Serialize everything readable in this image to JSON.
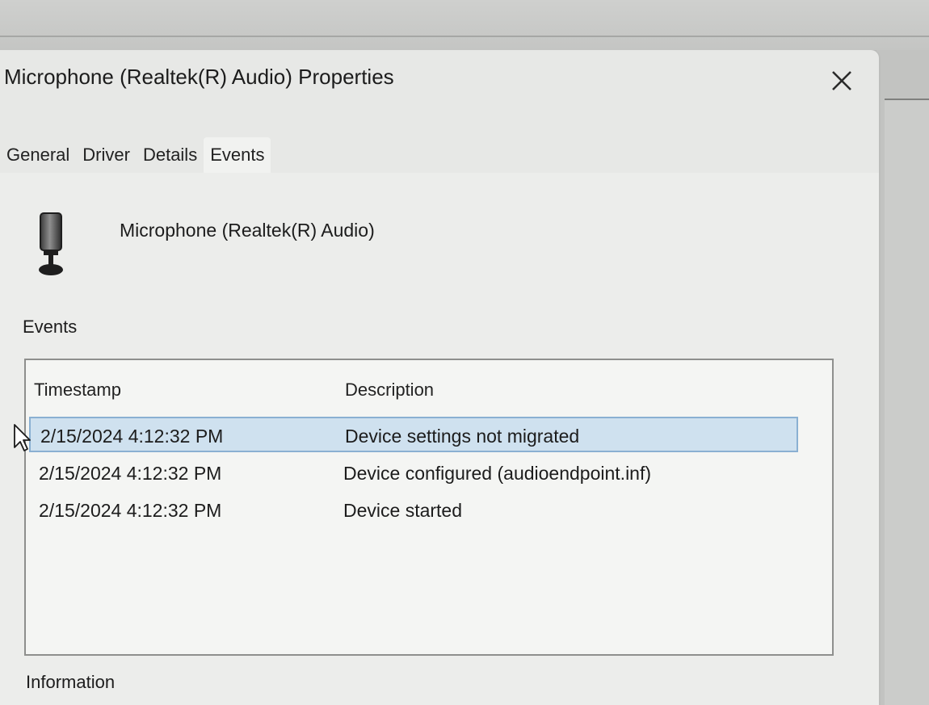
{
  "window": {
    "title": "Microphone (Realtek(R) Audio) Properties",
    "close_icon": "close-icon"
  },
  "tabs": [
    {
      "label": "General",
      "active": false
    },
    {
      "label": "Driver",
      "active": false
    },
    {
      "label": "Details",
      "active": false
    },
    {
      "label": "Events",
      "active": true
    }
  ],
  "device": {
    "icon": "microphone-icon",
    "name": "Microphone (Realtek(R) Audio)"
  },
  "events": {
    "label": "Events",
    "columns": {
      "timestamp": "Timestamp",
      "description": "Description"
    },
    "rows": [
      {
        "timestamp": "2/15/2024 4:12:32 PM",
        "description": "Device settings not migrated",
        "selected": true
      },
      {
        "timestamp": "2/15/2024 4:12:32 PM",
        "description": "Device configured (audioendpoint.inf)",
        "selected": false
      },
      {
        "timestamp": "2/15/2024 4:12:32 PM",
        "description": "Device started",
        "selected": false
      }
    ]
  },
  "information": {
    "label": "Information"
  },
  "colors": {
    "selection_fill": "#cfe1ef",
    "selection_border": "#8ab0d2",
    "dialog_background": "#e7e8e6"
  }
}
